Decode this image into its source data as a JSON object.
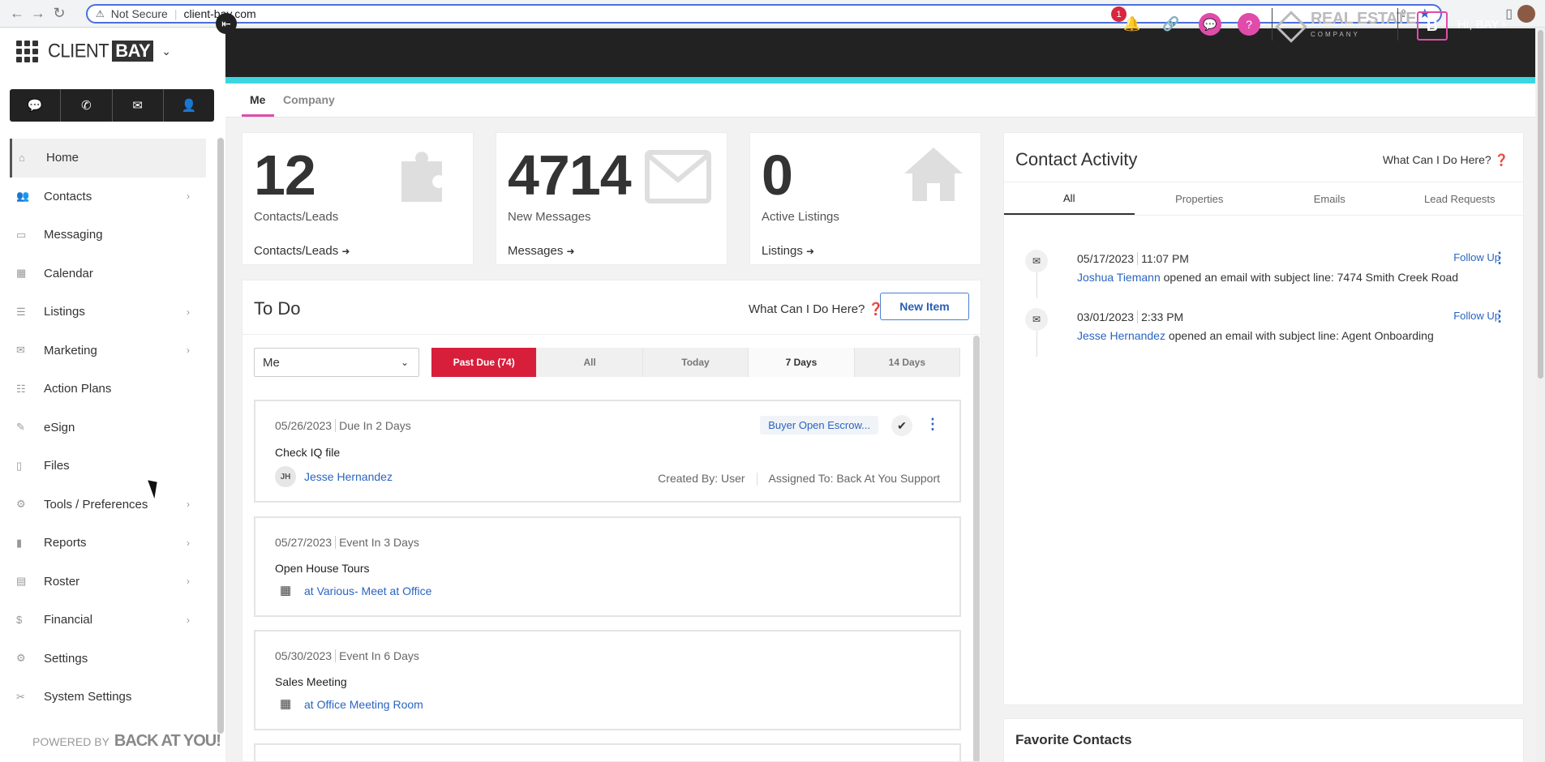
{
  "browser": {
    "security_label": "Not Secure",
    "url": "client-bay.com"
  },
  "brand": {
    "client": "CLIENT",
    "bay": "BAY",
    "powered_by": "POWERED BY",
    "powered_brand": "BACK AT YOU!"
  },
  "sidebar": {
    "items": [
      {
        "label": "Home",
        "icon": "home-icon",
        "has_submenu": false
      },
      {
        "label": "Contacts",
        "icon": "contacts-icon",
        "has_submenu": true
      },
      {
        "label": "Messaging",
        "icon": "messaging-icon",
        "has_submenu": false
      },
      {
        "label": "Calendar",
        "icon": "calendar-icon",
        "has_submenu": false
      },
      {
        "label": "Listings",
        "icon": "listings-icon",
        "has_submenu": true
      },
      {
        "label": "Marketing",
        "icon": "marketing-icon",
        "has_submenu": true
      },
      {
        "label": "Action Plans",
        "icon": "action-plans-icon",
        "has_submenu": false
      },
      {
        "label": "eSign",
        "icon": "esign-icon",
        "has_submenu": false
      },
      {
        "label": "Files",
        "icon": "files-icon",
        "has_submenu": false
      },
      {
        "label": "Tools / Preferences",
        "icon": "tools-icon",
        "has_submenu": true
      },
      {
        "label": "Reports",
        "icon": "reports-icon",
        "has_submenu": true
      },
      {
        "label": "Roster",
        "icon": "roster-icon",
        "has_submenu": true
      },
      {
        "label": "Financial",
        "icon": "financial-icon",
        "has_submenu": true
      },
      {
        "label": "Settings",
        "icon": "settings-icon",
        "has_submenu": false
      },
      {
        "label": "System Settings",
        "icon": "system-settings-icon",
        "has_submenu": false
      }
    ]
  },
  "header": {
    "notification_count": "1",
    "company_name": "REAL ESTATE",
    "company_sub": "COMPANY",
    "user_initial": "B",
    "greeting": "Hi, BAY"
  },
  "scope_tabs": {
    "me": "Me",
    "company": "Company"
  },
  "stats": [
    {
      "value": "12",
      "label": "Contacts/Leads",
      "link": "Contacts/Leads"
    },
    {
      "value": "4714",
      "label": "New Messages",
      "link": "Messages"
    },
    {
      "value": "0",
      "label": "Active Listings",
      "link": "Listings"
    }
  ],
  "todo": {
    "title": "To Do",
    "help": "What Can I Do Here?",
    "new_item": "New Item",
    "assignee": "Me",
    "filters": [
      "Past Due (74)",
      "All",
      "Today",
      "7 Days",
      "14 Days"
    ],
    "tasks": [
      {
        "date": "05/26/2023",
        "due": "Due In 2 Days",
        "title": "Check IQ file",
        "avatar": "JH",
        "link": "Jesse Hernandez",
        "tag": "Buyer Open Escrow...",
        "created_by": "Created By: User",
        "assigned_to": "Assigned To: Back At You Support"
      },
      {
        "date": "05/27/2023",
        "due": "Event In 3 Days",
        "title": "Open House Tours",
        "link": "at Various- Meet at Office"
      },
      {
        "date": "05/30/2023",
        "due": "Event In 6 Days",
        "title": "Sales Meeting",
        "link": "at Office Meeting Room"
      }
    ]
  },
  "activity": {
    "title": "Contact Activity",
    "help": "What Can I Do Here?",
    "tabs": [
      "All",
      "Properties",
      "Emails",
      "Lead Requests"
    ],
    "rows": [
      {
        "date": "05/17/2023",
        "time": "11:07 PM",
        "name": "Joshua Tiemann",
        "text": "opened an email with subject line: 7474 Smith Creek Road",
        "action": "Follow Up"
      },
      {
        "date": "03/01/2023",
        "time": "2:33 PM",
        "name": "Jesse Hernandez",
        "text": "opened an email with subject line: Agent Onboarding",
        "action": "Follow Up"
      }
    ]
  },
  "favorites": {
    "title": "Favorite Contacts"
  },
  "colors": {
    "accent": "#3bd6e0",
    "pink": "#e04caa",
    "past_due": "#d71f3b",
    "link": "#2a64c0"
  }
}
